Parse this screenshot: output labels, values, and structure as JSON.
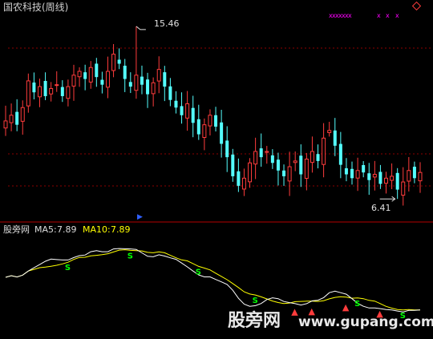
{
  "main_panel": {
    "title": "国农科技(周线)",
    "high_label": "15.46",
    "low_label": "6.41",
    "buy_marker": "▶"
  },
  "indicator_panel": {
    "name": "股旁网",
    "ma5_label": "MA5:",
    "ma5_value": "7.89",
    "ma10_label": "MA10:",
    "ma10_value": "7.89"
  },
  "watermark": {
    "cn": "股旁网",
    "url": "www.gupang.com"
  },
  "colors": {
    "up": "#ff3c3c",
    "down": "#54ffff",
    "ma5": "#ffffff",
    "ma10": "#ffff00",
    "signal": "#00ff00",
    "cross": "#ff00ff",
    "grid": "#8b0000",
    "separator": "#b30000"
  },
  "chart_data": {
    "type": "candlestick",
    "period": "weekly",
    "high": 15.46,
    "low": 6.41,
    "ma5": 7.89,
    "ma10": 7.89,
    "sell_signal_label": "S",
    "cross_marker": "x",
    "up_arrow": "▲",
    "close_series": [
      10.5,
      10.8,
      10.3,
      11.2,
      12.6,
      12.0,
      12.3,
      11.8,
      12.2,
      12.4,
      11.8,
      12.3,
      12.9,
      13.1,
      12.7,
      13.3,
      12.8,
      12.4,
      13.1,
      14.0,
      13.5,
      12.7,
      12.3,
      12.9,
      12.4,
      11.9,
      12.5,
      13.2,
      12.3,
      11.6,
      11.2,
      10.8,
      11.4,
      10.4,
      9.8,
      10.3,
      10.8,
      10.2,
      9.3,
      8.6,
      7.6,
      7.1,
      7.5,
      8.3,
      8.9,
      8.6,
      8.9,
      8.3,
      7.9,
      7.6,
      8.1,
      8.4,
      7.7,
      8.5,
      8.9,
      8.4,
      9.6,
      10.0,
      9.2,
      8.2,
      7.7,
      7.5,
      7.9,
      7.8,
      7.4,
      7.7,
      7.2,
      7.5,
      7.6,
      6.9,
      7.3,
      7.9,
      7.5,
      7.8
    ]
  }
}
